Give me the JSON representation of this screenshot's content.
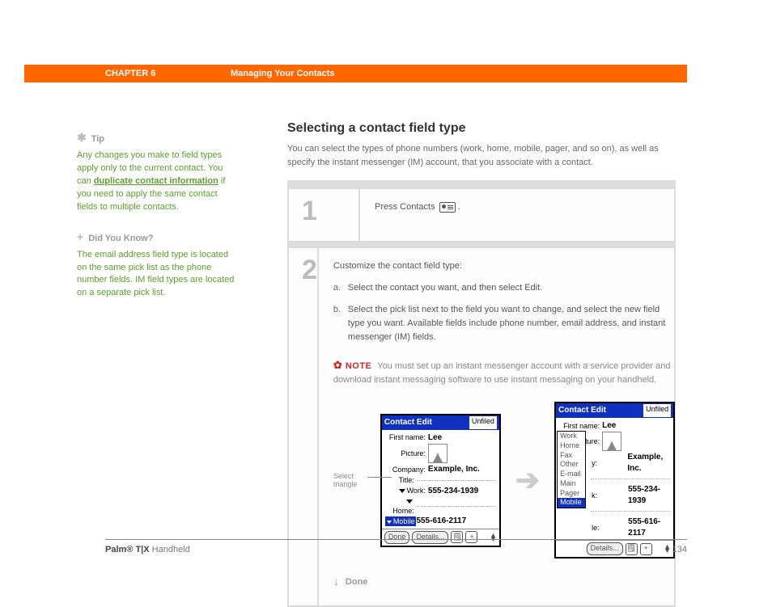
{
  "header": {
    "chapter": "CHAPTER 6",
    "title": "Managing Your Contacts"
  },
  "sidebar": {
    "tip": {
      "heading": "Tip",
      "body_pre": "Any changes you make to field types apply only to the current contact. You can ",
      "link": "duplicate contact information",
      "body_post": " if you need to apply the same contact fields to multiple contacts."
    },
    "dyk": {
      "heading": "Did You Know?",
      "body": "The email address field type is located on the same pick list as the phone number fields. IM field types are located on a separate pick list."
    }
  },
  "main": {
    "heading": "Selecting a contact field type",
    "intro": "You can select the types of phone numbers (work, home, mobile, pager, and so on), as well as specify the instant messenger (IM) account, that you associate with a contact.",
    "step1": {
      "num": "1",
      "text": "Press Contacts "
    },
    "step2": {
      "num": "2",
      "lead": "Customize the contact field type:",
      "a": "Select the contact you want, and then select Edit.",
      "b": "Select the pick list next to the field you want to change, and select the new field type you want. Available fields include phone number, email address, and instant messenger (IM) fields.",
      "note_label": "NOTE",
      "note_text": "You must set up an instant messenger account with a service provider and download instant messaging software to use instant messaging on your handheld."
    },
    "annotation": "Select triangle",
    "done": "Done"
  },
  "pda": {
    "title": "Contact Edit",
    "category": "Unfiled",
    "firstname_lbl": "First name:",
    "firstname": "Lee",
    "picture_lbl": "Picture:",
    "company_lbl": "Company:",
    "company": "Example, Inc.",
    "title_lbl": "Title:",
    "work_lbl": "Work:",
    "work": "555-234-1939",
    "home_lbl": "Home:",
    "mobile_lbl": "Mobile",
    "mobile": "555-616-2117",
    "done_btn": "Done",
    "details_btn": "Details...",
    "note_ico": "🗒",
    "plus_ico": "+",
    "picklist": [
      "Work",
      "Home",
      "Fax",
      "Other",
      "E-mail",
      "Main",
      "Pager",
      "Mobile"
    ],
    "partial_y": "y:",
    "partial_k": "k:",
    "partial_le": "le:"
  },
  "footer": {
    "brand_bold": "Palm",
    "brand_mid": "® T|X",
    "brand_tail": " Handheld",
    "page": "134"
  }
}
